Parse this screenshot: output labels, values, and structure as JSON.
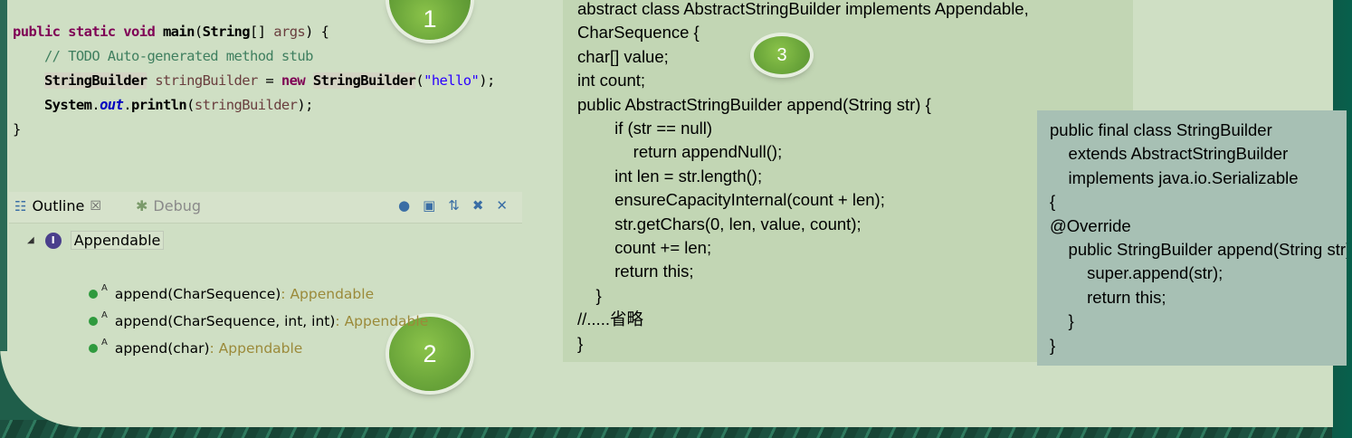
{
  "code_editor": {
    "lines": [
      "public static void main(String[] args) {",
      "    // TODO Auto-generated method stub",
      "    StringBuilder stringBuilder = new StringBuilder(\"hello\");",
      "    System.out.println(stringBuilder);",
      "}"
    ]
  },
  "badges": {
    "b1": "1",
    "b2": "2",
    "b3": "3"
  },
  "outline_panel": {
    "tabs": [
      {
        "label": "Outline",
        "close": "☒"
      },
      {
        "label": "Debug"
      }
    ],
    "tree": {
      "interface_name": "Appendable",
      "interface_glyph": "I",
      "methods": [
        {
          "name": "append(CharSequence)",
          "return_type": " : Appendable",
          "modifier": "A"
        },
        {
          "name": "append(CharSequence, int, int)",
          "return_type": " : Appendable",
          "modifier": "A"
        },
        {
          "name": "append(char)",
          "return_type": " : Appendable",
          "modifier": "A"
        }
      ]
    },
    "toolbar_icons": [
      "hide-fields-icon",
      "collapse-all-icon",
      "sort-az-icon",
      "hide-static-icon",
      "hide-nonpublic-icon"
    ]
  },
  "abstract_block": {
    "text": "abstract class AbstractStringBuilder implements Appendable,\nCharSequence {\nchar[] value;\nint count;\npublic AbstractStringBuilder append(String str) {\n        if (str == null)\n            return appendNull();\n        int len = str.length();\n        ensureCapacityInternal(count + len);\n        str.getChars(0, len, value, count);\n        count += len;\n        return this;\n    }\n//.....省略\n}"
  },
  "stringbuilder_block": {
    "text": "public final class StringBuilder\n    extends AbstractStringBuilder\n    implements java.io.Serializable\n{\n@Override\n    public StringBuilder append(String str) {\n        super.append(str);\n        return this;\n    }\n}"
  },
  "colors": {
    "slide_background": "#cfdfc4",
    "frame_green": "#1f5e4a",
    "badge_green": "#6aa53a"
  }
}
